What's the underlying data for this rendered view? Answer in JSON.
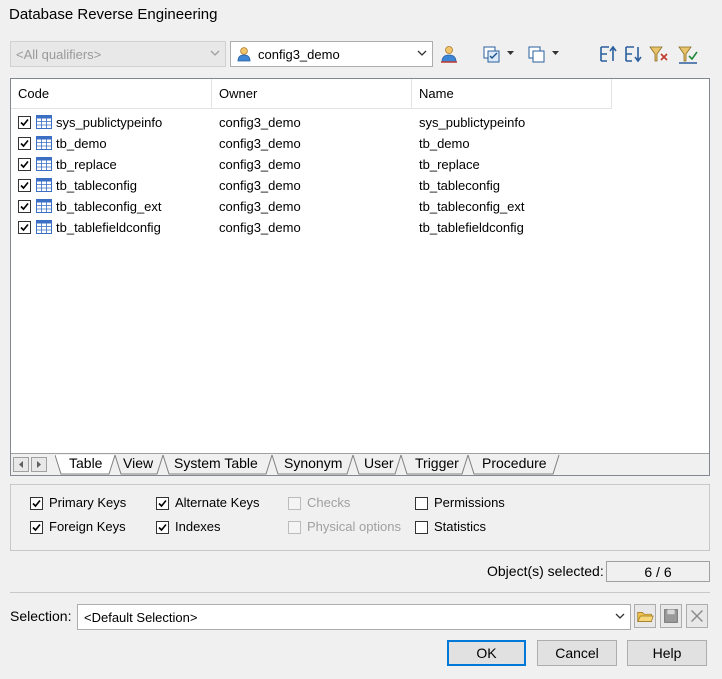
{
  "window": {
    "title": "Database Reverse Engineering"
  },
  "toolbar": {
    "qualifier": "<All qualifiers>",
    "owner": "config3_demo"
  },
  "grid": {
    "columns": [
      "Code",
      "Owner",
      "Name"
    ],
    "rows": [
      {
        "checked": true,
        "code": "sys_publictypeinfo",
        "owner": "config3_demo",
        "name": "sys_publictypeinfo"
      },
      {
        "checked": true,
        "code": "tb_demo",
        "owner": "config3_demo",
        "name": "tb_demo"
      },
      {
        "checked": true,
        "code": "tb_replace",
        "owner": "config3_demo",
        "name": "tb_replace"
      },
      {
        "checked": true,
        "code": "tb_tableconfig",
        "owner": "config3_demo",
        "name": "tb_tableconfig"
      },
      {
        "checked": true,
        "code": "tb_tableconfig_ext",
        "owner": "config3_demo",
        "name": "tb_tableconfig_ext"
      },
      {
        "checked": true,
        "code": "tb_tablefieldconfig",
        "owner": "config3_demo",
        "name": "tb_tablefieldconfig"
      }
    ]
  },
  "tabs": [
    "Table",
    "View",
    "System Table",
    "Synonym",
    "User",
    "Trigger",
    "Procedure"
  ],
  "options": {
    "primary_keys": {
      "label": "Primary Keys",
      "checked": true,
      "enabled": true
    },
    "foreign_keys": {
      "label": "Foreign Keys",
      "checked": true,
      "enabled": true
    },
    "alternate_keys": {
      "label": "Alternate Keys",
      "checked": true,
      "enabled": true
    },
    "indexes": {
      "label": "Indexes",
      "checked": true,
      "enabled": true
    },
    "checks": {
      "label": "Checks",
      "checked": false,
      "enabled": false
    },
    "physical_options": {
      "label": "Physical options",
      "checked": false,
      "enabled": false
    },
    "permissions": {
      "label": "Permissions",
      "checked": false,
      "enabled": true
    },
    "statistics": {
      "label": "Statistics",
      "checked": false,
      "enabled": true
    }
  },
  "status": {
    "label": "Object(s) selected:",
    "value": "6 / 6"
  },
  "selection": {
    "label": "Selection:",
    "value": "<Default Selection>"
  },
  "buttons": {
    "ok": "OK",
    "cancel": "Cancel",
    "help": "Help"
  },
  "colors": {
    "accent": "#0078d7",
    "table_icon": "#3a6fc4"
  }
}
